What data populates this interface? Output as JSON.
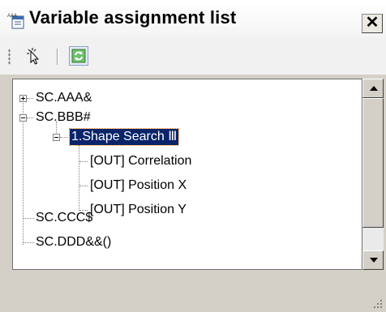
{
  "window": {
    "title": "Variable assignment list",
    "close_label": "✕",
    "title_icon": "list-document-icon"
  },
  "toolbar": {
    "buttons": [
      {
        "icon": "select-pointer-icon"
      },
      {
        "icon": "refresh-icon"
      }
    ]
  },
  "tree": {
    "nodes": [
      {
        "label": "SC.AAA&",
        "expander": "+"
      },
      {
        "label": "SC.BBB#",
        "expander": "-"
      },
      {
        "label": "1.Shape Search Ⅲ",
        "expander": "-",
        "selected": true
      },
      {
        "label": "[OUT] Correlation"
      },
      {
        "label": "[OUT] Position X"
      },
      {
        "label": "[OUT] Position Y"
      },
      {
        "label": "SC.CCC$"
      },
      {
        "label": "SC.DDD&&()"
      }
    ]
  },
  "colors": {
    "selection": "#0a246a",
    "window_bg": "#d4d0c8",
    "tree_bg": "#ffffff"
  }
}
